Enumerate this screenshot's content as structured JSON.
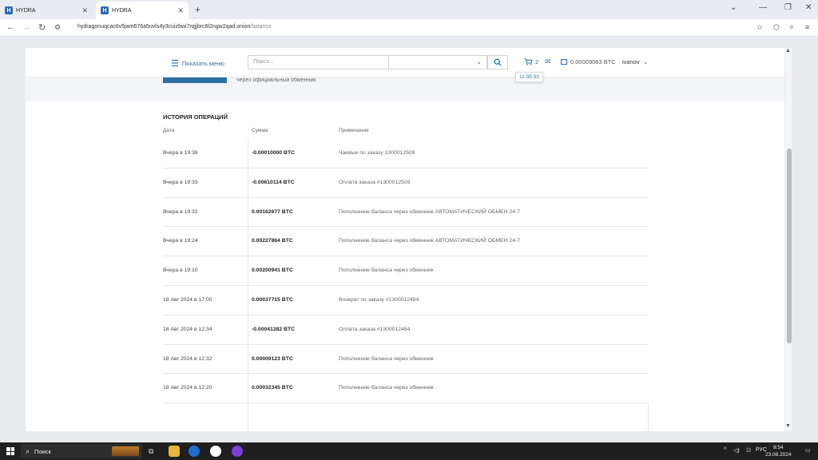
{
  "browser": {
    "tabs": [
      {
        "title": "HYDRA",
        "favicon": "H",
        "active": false
      },
      {
        "title": "HYDRA",
        "favicon": "H",
        "active": true
      }
    ],
    "url_host": "hydragonuqcac6v5jam676a5uvls4y3cuizbwi7rqjjbrc6l2ngw2qad.onion",
    "url_path": "/balance"
  },
  "topnav": {
    "menu_label": "Показать меню",
    "search_placeholder": "Поиск...",
    "cart_count": "2",
    "balance": "0.00009083 BTC",
    "username": "ivanov",
    "tooltip_time": "11:35:33"
  },
  "info": {
    "text": "через официальный обменник"
  },
  "history": {
    "title": "ИСТОРИЯ ОПЕРАЦИЙ",
    "columns": {
      "date": "Дата",
      "amount": "Сумма",
      "note": "Примечание"
    },
    "rows": [
      {
        "date": "Вчера в 19:36",
        "amount": "-0.00010000 BTC",
        "note": "Чаевые по заказу 1300012509"
      },
      {
        "date": "Вчера в 19:33",
        "amount": "-0.00610114 BTC",
        "note": "Оплата заказа #1300012509"
      },
      {
        "date": "Вчера в 19:32",
        "amount": "0.00162677 BTC",
        "note": "Пополнение баланса через обменник АВТОМАТИЧЕСКИЙ ОБМЕН 24-7"
      },
      {
        "date": "Вчера в 19:24",
        "amount": "0.00227864 BTC",
        "note": "Пополнение баланса через обменник АВТОМАТИЧЕСКИЙ ОБМЕН 24-7"
      },
      {
        "date": "Вчера в 19:10",
        "amount": "0.00200941 BTC",
        "note": "Пополнение баланса через обменник"
      },
      {
        "date": "18 Авг 2024 в 17:00",
        "amount": "0.00037715 BTC",
        "note": "Возврат по заказу #1300012484"
      },
      {
        "date": "18 Авг 2024 в 12:34",
        "amount": "-0.00041282 BTC",
        "note": "Оплата заказа #1300012484"
      },
      {
        "date": "18 Авг 2024 в 12:32",
        "amount": "0.00009123 BTC",
        "note": "Пополнение баланса через обменник"
      },
      {
        "date": "18 Авг 2024 в 12:20",
        "amount": "0.00032345 BTC",
        "note": "Пополнение баланса через обменник"
      }
    ]
  },
  "taskbar": {
    "search_label": "Поиск",
    "language": "РУС",
    "time": "8:54",
    "date": "23.08.2024"
  },
  "colors": {
    "accent": "#2d6fa3",
    "taskbar": "#1f1f1f"
  }
}
